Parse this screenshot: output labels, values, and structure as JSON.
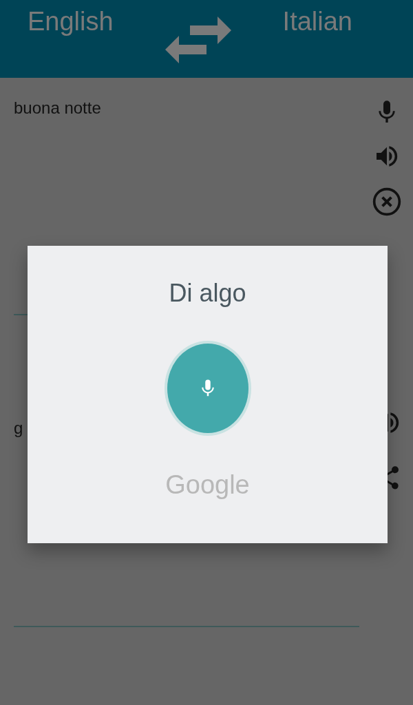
{
  "header": {
    "source_language": "English",
    "target_language": "Italian"
  },
  "input": {
    "text": "buona notte"
  },
  "output": {
    "text": "g"
  },
  "voice_dialog": {
    "prompt": "Di algo",
    "brand": "Google"
  }
}
